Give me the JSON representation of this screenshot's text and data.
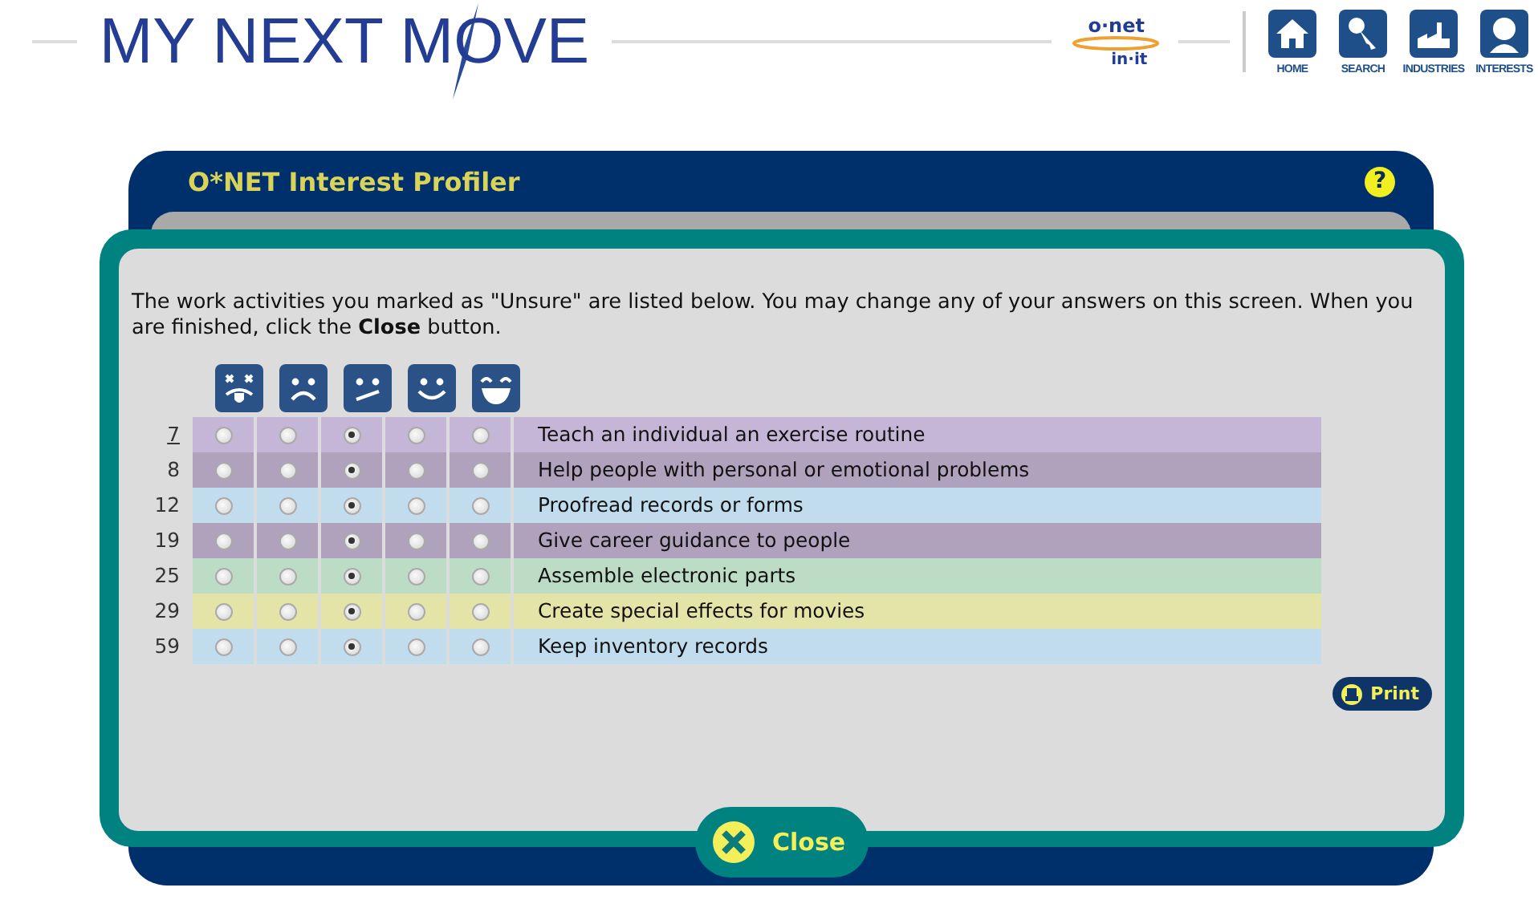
{
  "header": {
    "logo": "MY NEXT MOVE",
    "partner_logo": {
      "top": "o·net",
      "bottom": "in·it"
    },
    "nav": [
      {
        "label": "HOME",
        "kind": "home"
      },
      {
        "label": "SEARCH",
        "kind": "search"
      },
      {
        "label": "INDUSTRIES",
        "kind": "industries"
      },
      {
        "label": "INTERESTS",
        "kind": "interests"
      }
    ]
  },
  "panel": {
    "title": "O*NET Interest Profiler",
    "help": "?"
  },
  "intro": "The work activities you marked as \"Unsure\" are listed below. You may change any of your answers on this screen. When you are finished, click the **Close** button.",
  "rows": [
    {
      "number": "7",
      "link": true,
      "color": "#c5b6d8",
      "text": "Teach an individual an exercise routine",
      "answers": [
        {
          "selected": false
        },
        {
          "selected": false
        },
        {
          "selected": true
        },
        {
          "selected": false
        },
        {
          "selected": false
        }
      ]
    },
    {
      "number": "8",
      "link": false,
      "color": "#b0a1bd",
      "text": "Help people with personal or emotional problems",
      "answers": [
        {
          "selected": false
        },
        {
          "selected": false
        },
        {
          "selected": true
        },
        {
          "selected": false
        },
        {
          "selected": false
        }
      ]
    },
    {
      "number": "12",
      "link": false,
      "color": "#c1dced",
      "text": "Proofread records or forms",
      "answers": [
        {
          "selected": false
        },
        {
          "selected": false
        },
        {
          "selected": true
        },
        {
          "selected": false
        },
        {
          "selected": false
        }
      ]
    },
    {
      "number": "19",
      "link": false,
      "color": "#b0a1bd",
      "text": "Give career guidance to people",
      "answers": [
        {
          "selected": false
        },
        {
          "selected": false
        },
        {
          "selected": true
        },
        {
          "selected": false
        },
        {
          "selected": false
        }
      ]
    },
    {
      "number": "25",
      "link": false,
      "color": "#bcdcc6",
      "text": "Assemble electronic parts",
      "answers": [
        {
          "selected": false
        },
        {
          "selected": false
        },
        {
          "selected": true
        },
        {
          "selected": false
        },
        {
          "selected": false
        }
      ]
    },
    {
      "number": "29",
      "link": false,
      "color": "#e5e4a8",
      "text": "Create special effects for movies",
      "answers": [
        {
          "selected": false
        },
        {
          "selected": false
        },
        {
          "selected": true
        },
        {
          "selected": false
        },
        {
          "selected": false
        }
      ]
    },
    {
      "number": "59",
      "link": false,
      "color": "#c1dced",
      "text": "Keep inventory records",
      "answers": [
        {
          "selected": false
        },
        {
          "selected": false
        },
        {
          "selected": true
        },
        {
          "selected": false
        },
        {
          "selected": false
        }
      ]
    }
  ],
  "buttons": {
    "print": "Print",
    "close": "Close"
  }
}
